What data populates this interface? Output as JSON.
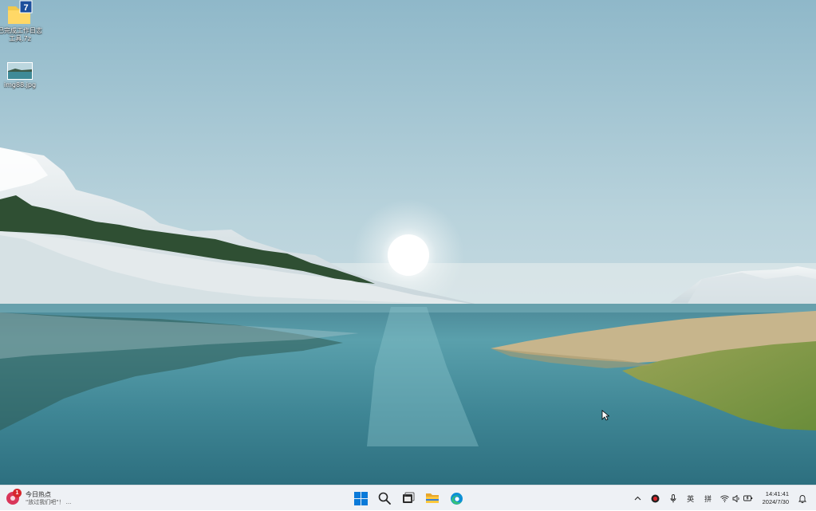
{
  "desktop": {
    "icons": [
      {
        "label": "已完成工作日志工具.7z",
        "icon": "7zip-archive-icon"
      },
      {
        "label": "img88.jpg",
        "icon": "image-file-icon"
      }
    ]
  },
  "taskbar": {
    "news": {
      "title": "今日热点",
      "subtitle": "\"放过我们吧\"！ ...",
      "badge": "1"
    },
    "center_apps": [
      {
        "name": "start-button",
        "icon": "windows-logo-icon"
      },
      {
        "name": "search-button",
        "icon": "search-icon"
      },
      {
        "name": "task-view-button",
        "icon": "task-view-icon"
      },
      {
        "name": "file-explorer-button",
        "icon": "folder-icon"
      },
      {
        "name": "edge-button",
        "icon": "edge-icon"
      }
    ],
    "tray": {
      "ime_lang": "英",
      "ime_mode": "拼",
      "time": "14:41:41",
      "date": "2024/7/30"
    }
  },
  "colors": {
    "taskbar_bg": "#eef1f5",
    "accent": "#0067c0"
  }
}
